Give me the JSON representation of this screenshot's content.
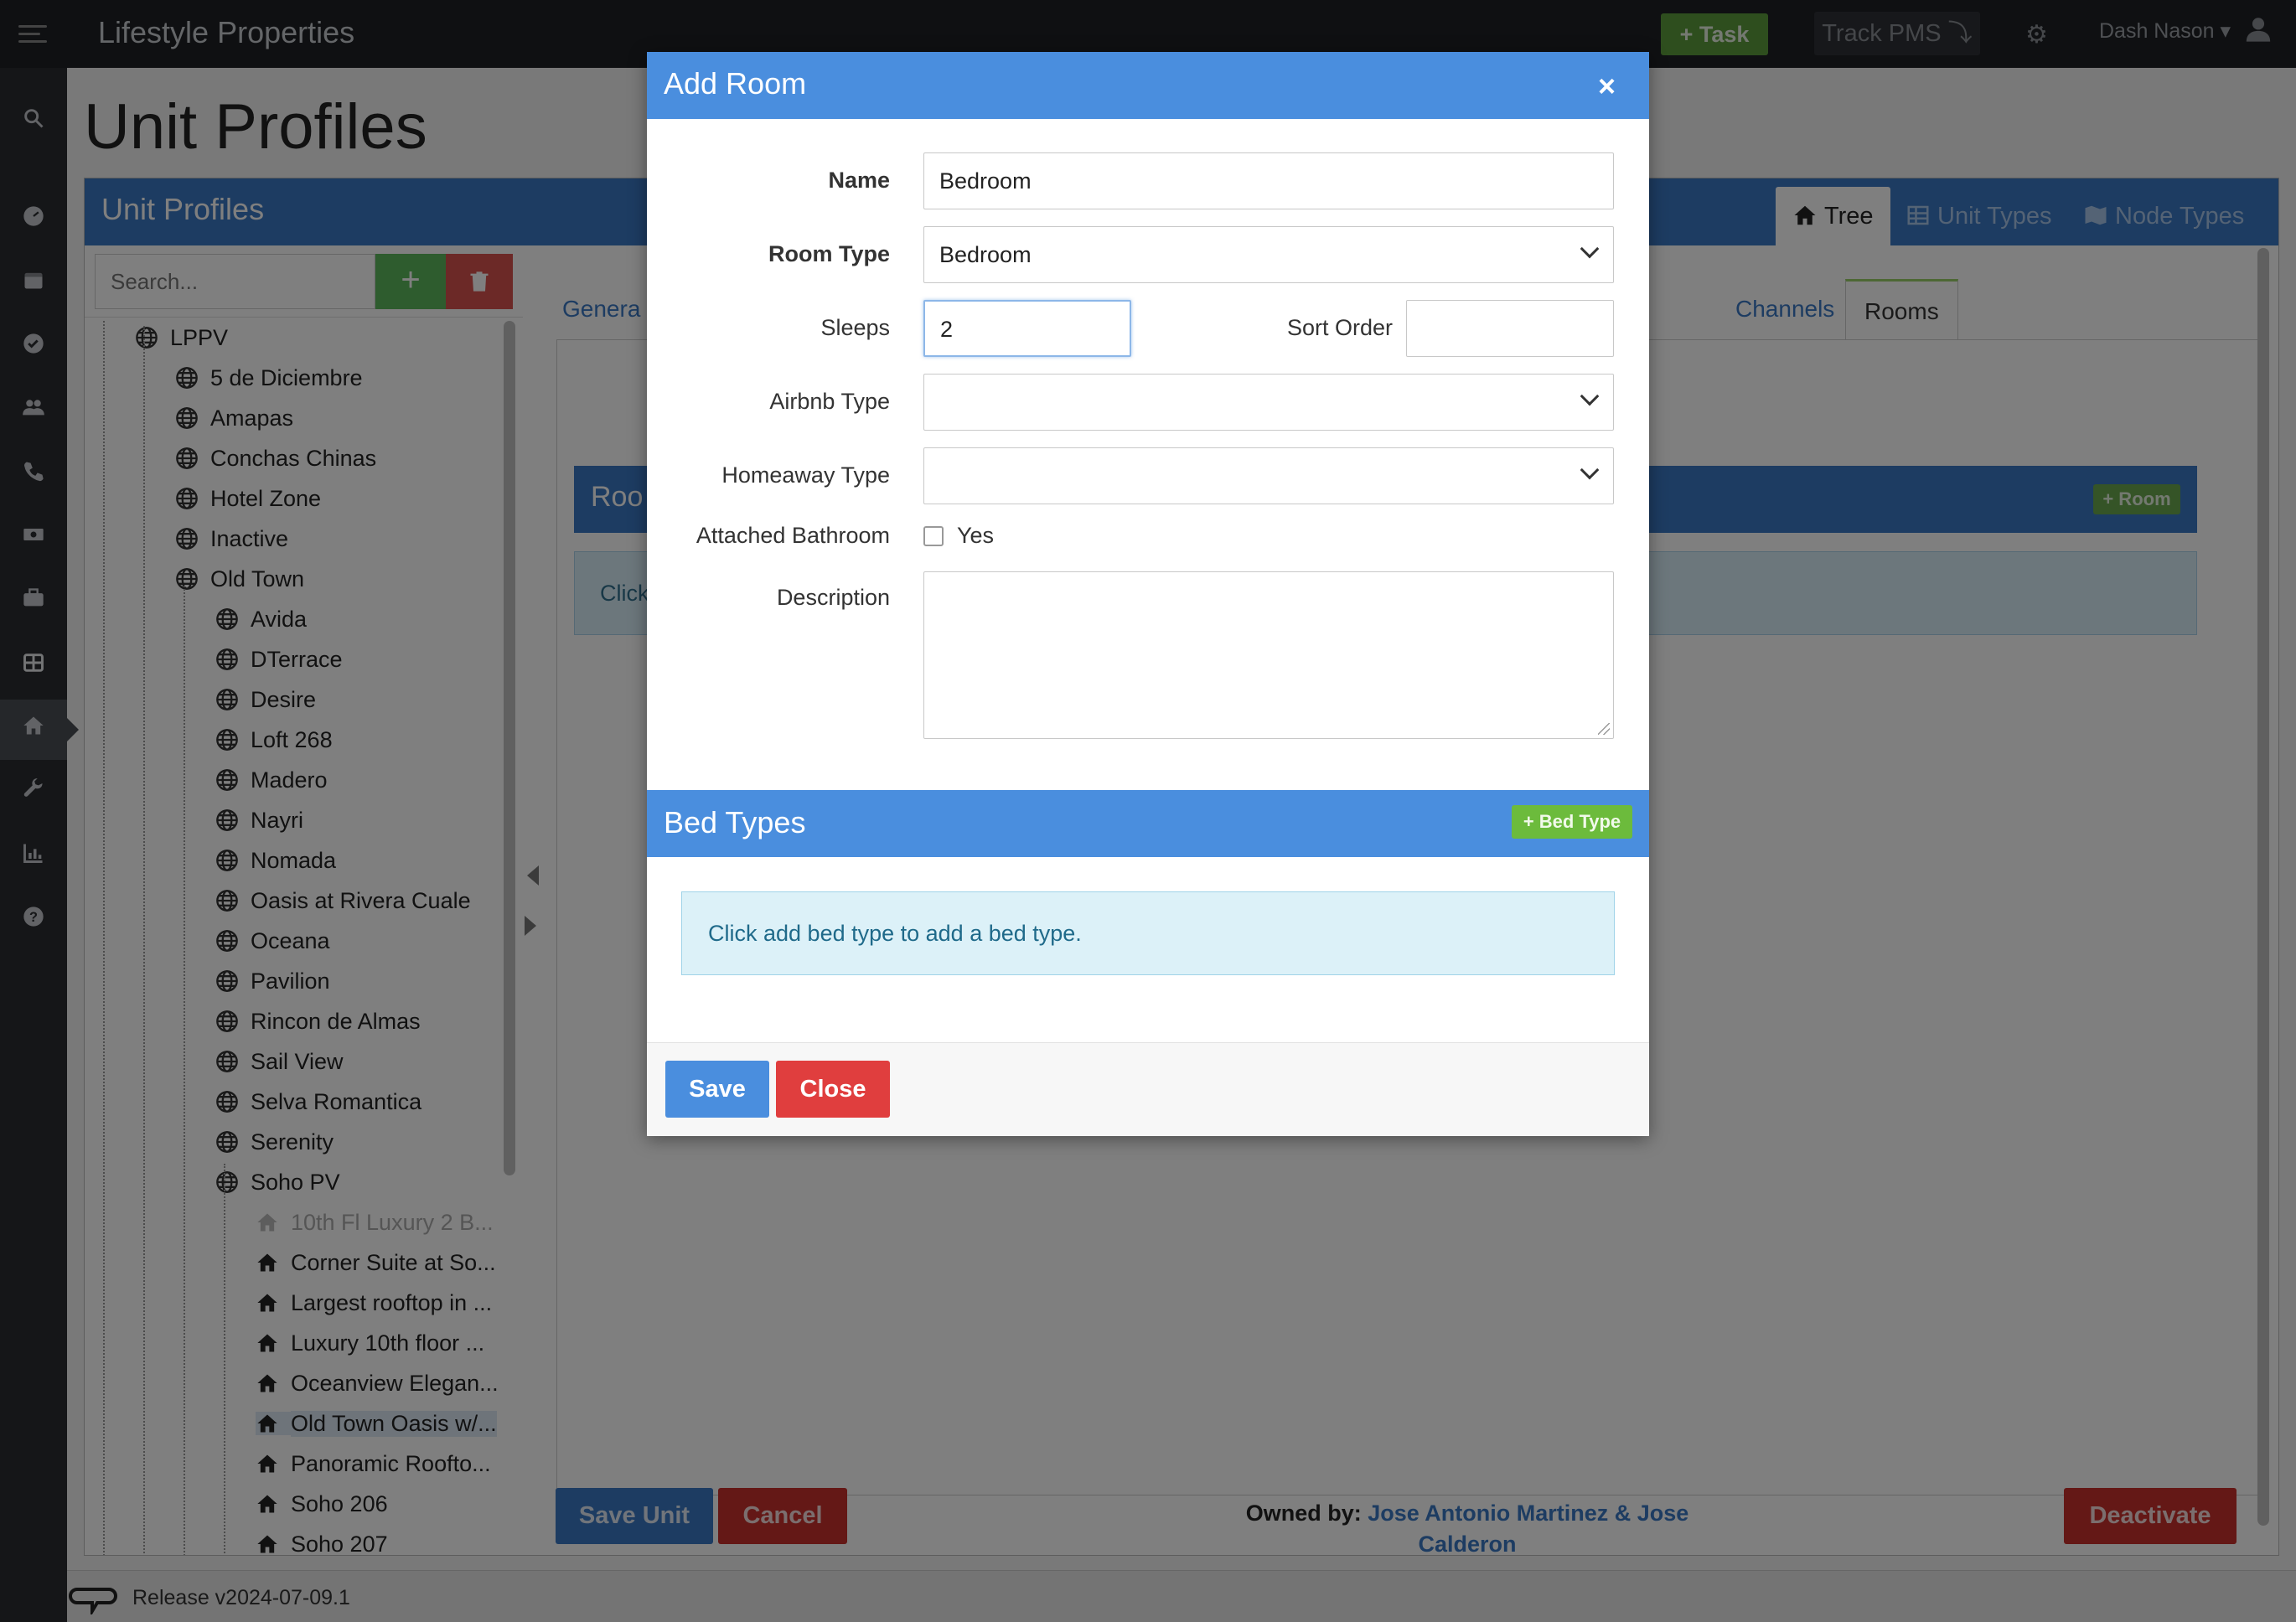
{
  "app": {
    "brand": "Lifestyle Properties"
  },
  "topbar": {
    "task_label": "+ Task",
    "track_label": "Track PMS ⤵",
    "user_name": "Dash Nason ▾"
  },
  "page": {
    "title": "Unit Profiles"
  },
  "panel": {
    "title": "Unit Profiles",
    "tabs": [
      {
        "label": "Tree",
        "active": true
      },
      {
        "label": "Unit Types"
      },
      {
        "label": "Node Types"
      }
    ]
  },
  "tree": {
    "search_placeholder": "Search...",
    "add_label": "+",
    "items": [
      {
        "label": "LPPV",
        "level": 0,
        "icon": "globe-icon"
      },
      {
        "label": "5 de Diciembre",
        "level": 1,
        "icon": "globe-icon"
      },
      {
        "label": "Amapas",
        "level": 1,
        "icon": "globe-icon"
      },
      {
        "label": "Conchas Chinas",
        "level": 1,
        "icon": "globe-icon"
      },
      {
        "label": "Hotel Zone",
        "level": 1,
        "icon": "globe-icon"
      },
      {
        "label": "Inactive",
        "level": 1,
        "icon": "globe-icon"
      },
      {
        "label": "Old Town",
        "level": 1,
        "icon": "globe-icon"
      },
      {
        "label": "Avida",
        "level": 2,
        "icon": "globe-icon"
      },
      {
        "label": "DTerrace",
        "level": 2,
        "icon": "globe-icon"
      },
      {
        "label": "Desire",
        "level": 2,
        "icon": "globe-icon"
      },
      {
        "label": "Loft 268",
        "level": 2,
        "icon": "globe-icon"
      },
      {
        "label": "Madero",
        "level": 2,
        "icon": "globe-icon"
      },
      {
        "label": "Nayri",
        "level": 2,
        "icon": "globe-icon"
      },
      {
        "label": "Nomada",
        "level": 2,
        "icon": "globe-icon"
      },
      {
        "label": "Oasis at Rivera Cuale",
        "level": 2,
        "icon": "globe-icon"
      },
      {
        "label": "Oceana",
        "level": 2,
        "icon": "globe-icon"
      },
      {
        "label": "Pavilion",
        "level": 2,
        "icon": "globe-icon"
      },
      {
        "label": "Rincon de Almas",
        "level": 2,
        "icon": "globe-icon"
      },
      {
        "label": "Sail View",
        "level": 2,
        "icon": "globe-icon"
      },
      {
        "label": "Selva Romantica",
        "level": 2,
        "icon": "globe-icon"
      },
      {
        "label": "Serenity",
        "level": 2,
        "icon": "globe-icon"
      },
      {
        "label": "Soho PV",
        "level": 2,
        "icon": "globe-icon"
      },
      {
        "label": "10th Fl Luxury 2 B...",
        "level": 3,
        "icon": "home-icon",
        "muted": true
      },
      {
        "label": "Corner Suite at So...",
        "level": 3,
        "icon": "home-icon"
      },
      {
        "label": "Largest rooftop in ...",
        "level": 3,
        "icon": "home-icon"
      },
      {
        "label": "Luxury 10th floor ...",
        "level": 3,
        "icon": "home-icon"
      },
      {
        "label": "Oceanview Elegan...",
        "level": 3,
        "icon": "home-icon"
      },
      {
        "label": "Old Town Oasis w/...",
        "level": 3,
        "icon": "home-icon",
        "selected": true
      },
      {
        "label": "Panoramic Roofto...",
        "level": 3,
        "icon": "home-icon"
      },
      {
        "label": "Soho 206",
        "level": 3,
        "icon": "home-icon"
      },
      {
        "label": "Soho 207",
        "level": 3,
        "icon": "home-icon"
      }
    ]
  },
  "content": {
    "tabs": [
      {
        "label": "Genera"
      },
      {
        "label": "Channels"
      },
      {
        "label": "Rooms",
        "active": true
      }
    ],
    "rooms_title": "Roo",
    "room_add_label": "+ Room",
    "rooms_info": "Click",
    "save_unit": "Save Unit",
    "cancel": "Cancel",
    "owned_prefix": "Owned by:",
    "owners_line1": "Jose Antonio Martinez & Jose",
    "owners_line2": "Calderon",
    "deactivate": "Deactivate"
  },
  "footer": {
    "release": "Release v2024-07-09.1"
  },
  "modal": {
    "title": "Add Room",
    "close_symbol": "×",
    "labels": {
      "name": "Name",
      "room_type": "Room Type",
      "sleeps": "Sleeps",
      "sort_order": "Sort Order",
      "airbnb_type": "Airbnb Type",
      "homeaway_type": "Homeaway Type",
      "attached_bathroom": "Attached Bathroom",
      "description": "Description"
    },
    "values": {
      "name": "Bedroom",
      "room_type": "Bedroom",
      "sleeps": "2",
      "sort_order": "",
      "airbnb_type": "",
      "homeaway_type": "",
      "attached_bathroom_checked": false,
      "attached_bathroom_option": "Yes",
      "description": ""
    },
    "bed_types": {
      "title": "Bed Types",
      "add_label": "+ Bed Type",
      "info": "Click add bed type to add a bed type."
    },
    "save": "Save",
    "close": "Close"
  },
  "colors": {
    "primary": "#4a8ede",
    "success": "#6cbb3c",
    "danger": "#e03e3e",
    "topbar": "#1f2125"
  }
}
